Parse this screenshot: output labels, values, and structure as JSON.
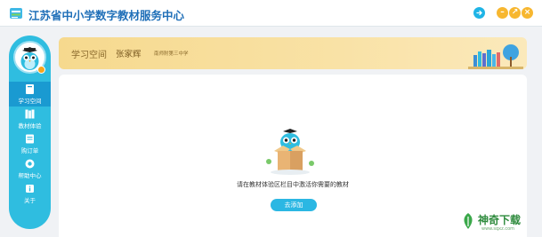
{
  "window": {
    "title": "江苏省中小学数字教材服务中心",
    "controls": {
      "export_icon": "export-icon",
      "minimize_glyph": "–",
      "maximize_glyph": "↗",
      "close_glyph": "×"
    }
  },
  "sidebar": {
    "items": [
      {
        "label": "学习空间",
        "icon": "book-icon",
        "active": true
      },
      {
        "label": "教材体验",
        "icon": "books-icon",
        "active": false
      },
      {
        "label": "购订单",
        "icon": "order-icon",
        "active": false
      },
      {
        "label": "帮助中心",
        "icon": "help-icon",
        "active": false
      },
      {
        "label": "关于",
        "icon": "info-icon",
        "active": false
      }
    ]
  },
  "banner": {
    "title": "学习空间",
    "user_name": "张家辉",
    "school": "南师附第三中学"
  },
  "content": {
    "empty_message": "请在教材体验区栏目中激活你需要的教材",
    "add_button_label": "去添加"
  },
  "watermark": {
    "text": "神奇下载",
    "sub": "www.sqxz.com"
  },
  "colors": {
    "sidebar": "#2fbde0",
    "sidebar_active": "#1a9ad1",
    "accent": "#2bb7e3",
    "banner": "#f6d98e",
    "title": "#1f6fb8"
  }
}
